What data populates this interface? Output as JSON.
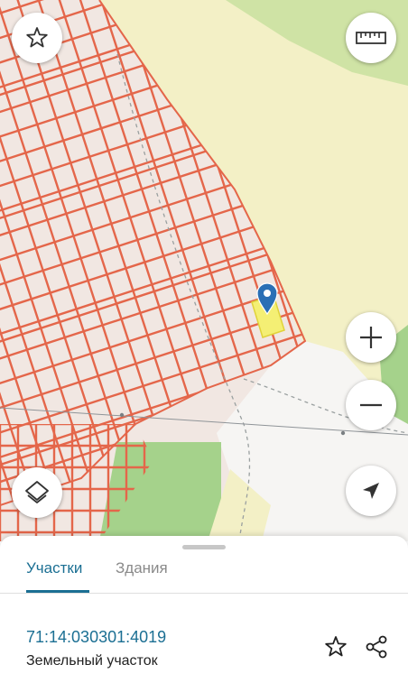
{
  "map": {
    "colors": {
      "background": "#f1e7e2",
      "field": "#f3f0c6",
      "forest": "#a5d28b",
      "road": "#f8f8f6",
      "parcel_lines": "#e4664a",
      "selected_parcel": "#f4ef74",
      "pin": "#2a6fb5"
    }
  },
  "controls": {
    "favorites": {
      "icon": "star-icon"
    },
    "ruler": {
      "icon": "ruler-icon"
    },
    "zoom_in": {
      "icon": "plus-icon"
    },
    "zoom_out": {
      "icon": "minus-icon"
    },
    "layers": {
      "icon": "layers-icon"
    },
    "locate": {
      "icon": "navigation-arrow-icon"
    }
  },
  "sheet": {
    "tabs": [
      {
        "label": "Участки",
        "active": true
      },
      {
        "label": "Здания",
        "active": false
      }
    ],
    "parcel": {
      "cadastral_number": "71:14:030301:4019",
      "type": "Земельный участок"
    },
    "actions": {
      "favorite_icon": "star-icon",
      "share_icon": "share-icon"
    },
    "accent_color": "#1b6f93"
  }
}
